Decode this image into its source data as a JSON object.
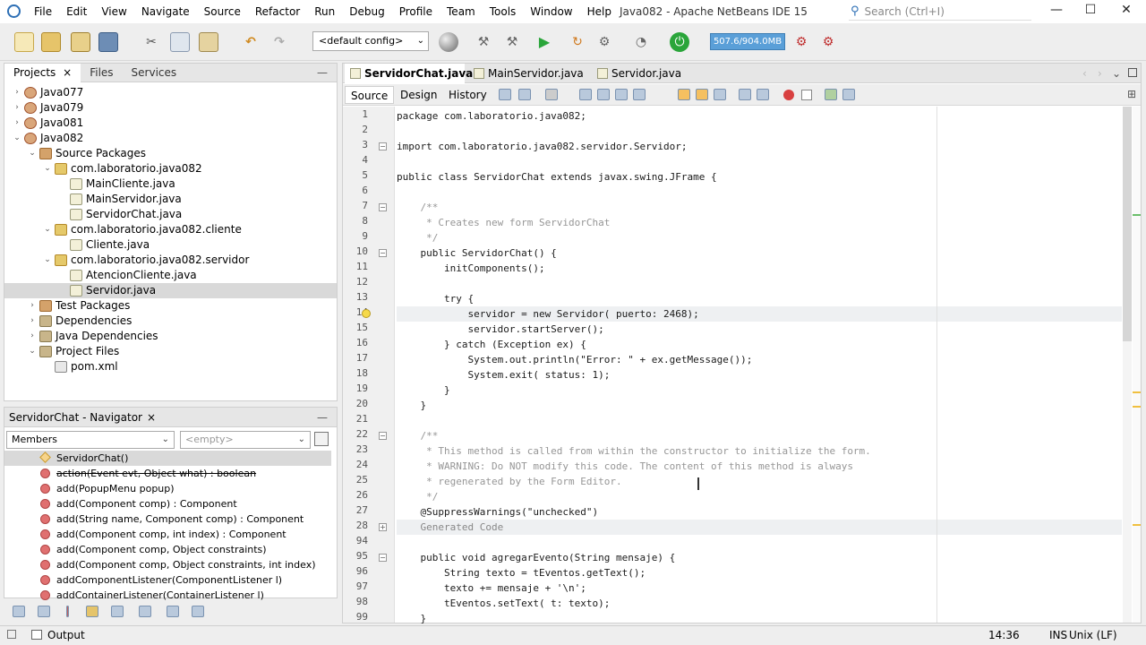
{
  "app": {
    "title": "Java082 - Apache NetBeans IDE 15",
    "menu": [
      "File",
      "Edit",
      "View",
      "Navigate",
      "Source",
      "Refactor",
      "Run",
      "Debug",
      "Profile",
      "Team",
      "Tools",
      "Window",
      "Help"
    ],
    "search_placeholder": "Search (Ctrl+I)",
    "window_controls": {
      "minimize": "—",
      "maximize": "☐",
      "close": "✕"
    }
  },
  "toolbar": {
    "config_label": "<default config>",
    "memory_label": "507.6/904.0MB"
  },
  "projects_panel": {
    "tabs": [
      "Projects",
      "Files",
      "Services"
    ],
    "tab_close": "×",
    "tree": [
      {
        "label": "Java077",
        "icon": "project-icon",
        "toggle": "›"
      },
      {
        "label": "Java079",
        "icon": "project-icon",
        "toggle": "›"
      },
      {
        "label": "Java081",
        "icon": "project-icon",
        "toggle": "›"
      },
      {
        "label": "Java082",
        "icon": "project-icon",
        "toggle": "⌄"
      },
      {
        "label": "Source Packages",
        "icon": "source-packages-icon",
        "toggle": "⌄"
      },
      {
        "label": "com.laboratorio.java082",
        "icon": "package-icon",
        "toggle": "⌄"
      },
      {
        "label": "MainCliente.java",
        "icon": "java-file-icon",
        "toggle": ""
      },
      {
        "label": "MainServidor.java",
        "icon": "java-file-icon",
        "toggle": ""
      },
      {
        "label": "ServidorChat.java",
        "icon": "java-file-icon",
        "toggle": ""
      },
      {
        "label": "com.laboratorio.java082.cliente",
        "icon": "package-icon",
        "toggle": "⌄"
      },
      {
        "label": "Cliente.java",
        "icon": "java-file-icon",
        "toggle": ""
      },
      {
        "label": "com.laboratorio.java082.servidor",
        "icon": "package-icon",
        "toggle": "⌄"
      },
      {
        "label": "AtencionCliente.java",
        "icon": "java-file-icon",
        "toggle": ""
      },
      {
        "label": "Servidor.java",
        "icon": "java-file-icon",
        "toggle": ""
      },
      {
        "label": "Test Packages",
        "icon": "test-packages-icon",
        "toggle": "›"
      },
      {
        "label": "Dependencies",
        "icon": "dependencies-icon",
        "toggle": "›"
      },
      {
        "label": "Java Dependencies",
        "icon": "java-dependencies-icon",
        "toggle": "›"
      },
      {
        "label": "Project Files",
        "icon": "project-files-icon",
        "toggle": "⌄"
      },
      {
        "label": "pom.xml",
        "icon": "xml-file-icon",
        "toggle": ""
      }
    ]
  },
  "navigator": {
    "title": "ServidorChat - Navigator",
    "filter_label": "Members",
    "secondary_label": "<empty>",
    "members": [
      "ServidorChat()",
      "action(Event evt, Object what) : boolean",
      "add(PopupMenu popup)",
      "add(Component comp) : Component",
      "add(String name, Component comp) : Component",
      "add(Component comp, int index) : Component",
      "add(Component comp, Object constraints)",
      "add(Component comp, Object constraints, int index)",
      "addComponentListener(ComponentListener l)",
      "addContainerListener(ContainerListener l)"
    ]
  },
  "editor": {
    "tabs": [
      "ServidorChat.java",
      "MainServidor.java",
      "Servidor.java"
    ],
    "tab_close": "×",
    "modes": [
      "Source",
      "Design",
      "History"
    ],
    "lines": [
      {
        "n": "1",
        "t": "package com.laboratorio.java082;"
      },
      {
        "n": "2",
        "t": ""
      },
      {
        "n": "3",
        "t": "import com.laboratorio.java082.servidor.Servidor;"
      },
      {
        "n": "4",
        "t": ""
      },
      {
        "n": "5",
        "t": "public class ServidorChat extends javax.swing.JFrame {"
      },
      {
        "n": "6",
        "t": ""
      },
      {
        "n": "7",
        "t": "    /**"
      },
      {
        "n": "8",
        "t": "     * Creates new form ServidorChat"
      },
      {
        "n": "9",
        "t": "     */"
      },
      {
        "n": "10",
        "t": "    public ServidorChat() {"
      },
      {
        "n": "11",
        "t": "        initComponents();"
      },
      {
        "n": "12",
        "t": ""
      },
      {
        "n": "13",
        "t": "        try {"
      },
      {
        "n": "14",
        "t": "            servidor = new Servidor( puerto: 2468);"
      },
      {
        "n": "15",
        "t": "            servidor.startServer();"
      },
      {
        "n": "16",
        "t": "        } catch (Exception ex) {"
      },
      {
        "n": "17",
        "t": "            System.out.println(\"Error: \" + ex.getMessage());"
      },
      {
        "n": "18",
        "t": "            System.exit( status: 1);"
      },
      {
        "n": "19",
        "t": "        }"
      },
      {
        "n": "20",
        "t": "    }"
      },
      {
        "n": "21",
        "t": ""
      },
      {
        "n": "22",
        "t": "    /**"
      },
      {
        "n": "23",
        "t": "     * This method is called from within the constructor to initialize the form."
      },
      {
        "n": "24",
        "t": "     * WARNING: Do NOT modify this code. The content of this method is always"
      },
      {
        "n": "25",
        "t": "     * regenerated by the Form Editor."
      },
      {
        "n": "26",
        "t": "     */"
      },
      {
        "n": "27",
        "t": "    @SuppressWarnings(\"unchecked\")"
      },
      {
        "n": "28",
        "t": "    Generated Code"
      },
      {
        "n": "94",
        "t": ""
      },
      {
        "n": "95",
        "t": "    public void agregarEvento(String mensaje) {"
      },
      {
        "n": "96",
        "t": "        String texto = tEventos.getText();"
      },
      {
        "n": "97",
        "t": "        texto += mensaje + '\\n';"
      },
      {
        "n": "98",
        "t": "        tEventos.setText( t: texto);"
      },
      {
        "n": "99",
        "t": "    }"
      }
    ]
  },
  "status": {
    "output_label": "Output",
    "position": "14:36",
    "insert_mode": "INS",
    "line_endings": "Unix (LF)"
  }
}
